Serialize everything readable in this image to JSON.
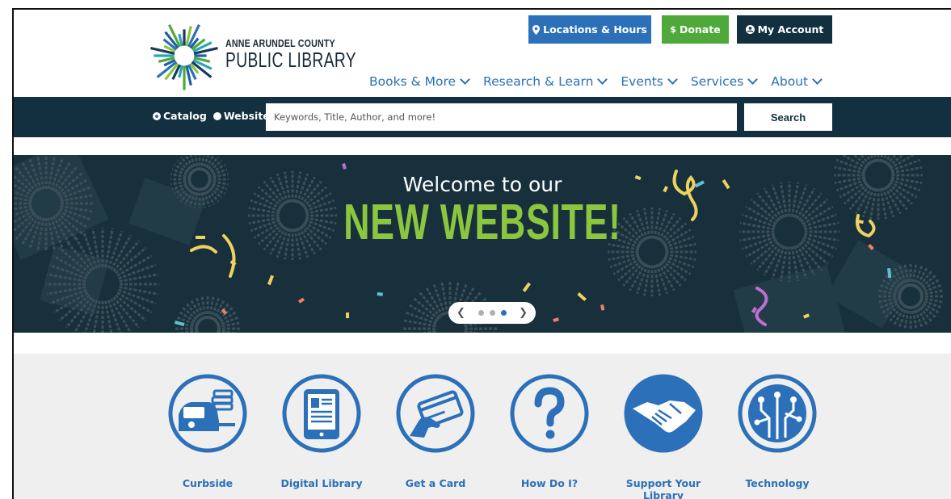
{
  "logo": {
    "line1": "ANNE ARUNDEL COUNTY",
    "line2": "PUBLIC LIBRARY"
  },
  "utility": {
    "locations": {
      "icon": "map-pin-icon",
      "label": "Locations & Hours"
    },
    "donate": {
      "icon": "dollar-icon",
      "label": "Donate"
    },
    "account": {
      "icon": "user-circle-icon",
      "label": "My Account"
    }
  },
  "nav": [
    {
      "label": "Books & More"
    },
    {
      "label": "Research & Learn"
    },
    {
      "label": "Events"
    },
    {
      "label": "Services"
    },
    {
      "label": "About"
    }
  ],
  "search": {
    "options": [
      {
        "label": "Catalog",
        "selected": true
      },
      {
        "label": "Website",
        "selected": false
      }
    ],
    "placeholder": "Keywords, Title, Author, and more!",
    "button": "Search"
  },
  "hero": {
    "kicker": "Welcome to our",
    "title": "NEW WEBSITE!",
    "slides": 3,
    "active_slide": 3
  },
  "quick_links": [
    {
      "label": "Curbside",
      "icon": "curbside-car-icon"
    },
    {
      "label": "Digital Library",
      "icon": "tablet-icon"
    },
    {
      "label": "Get a Card",
      "icon": "library-card-icon"
    },
    {
      "label": "How Do I?",
      "icon": "question-icon"
    },
    {
      "label": "Support Your Library",
      "icon": "handshake-icon"
    },
    {
      "label": "Technology",
      "icon": "circuit-icon"
    }
  ],
  "colors": {
    "brand_blue": "#2b70b8",
    "dark_navy": "#12303f",
    "green": "#4ea93a",
    "hero_green": "#8cc63f",
    "hero_bg": "#17303b"
  }
}
